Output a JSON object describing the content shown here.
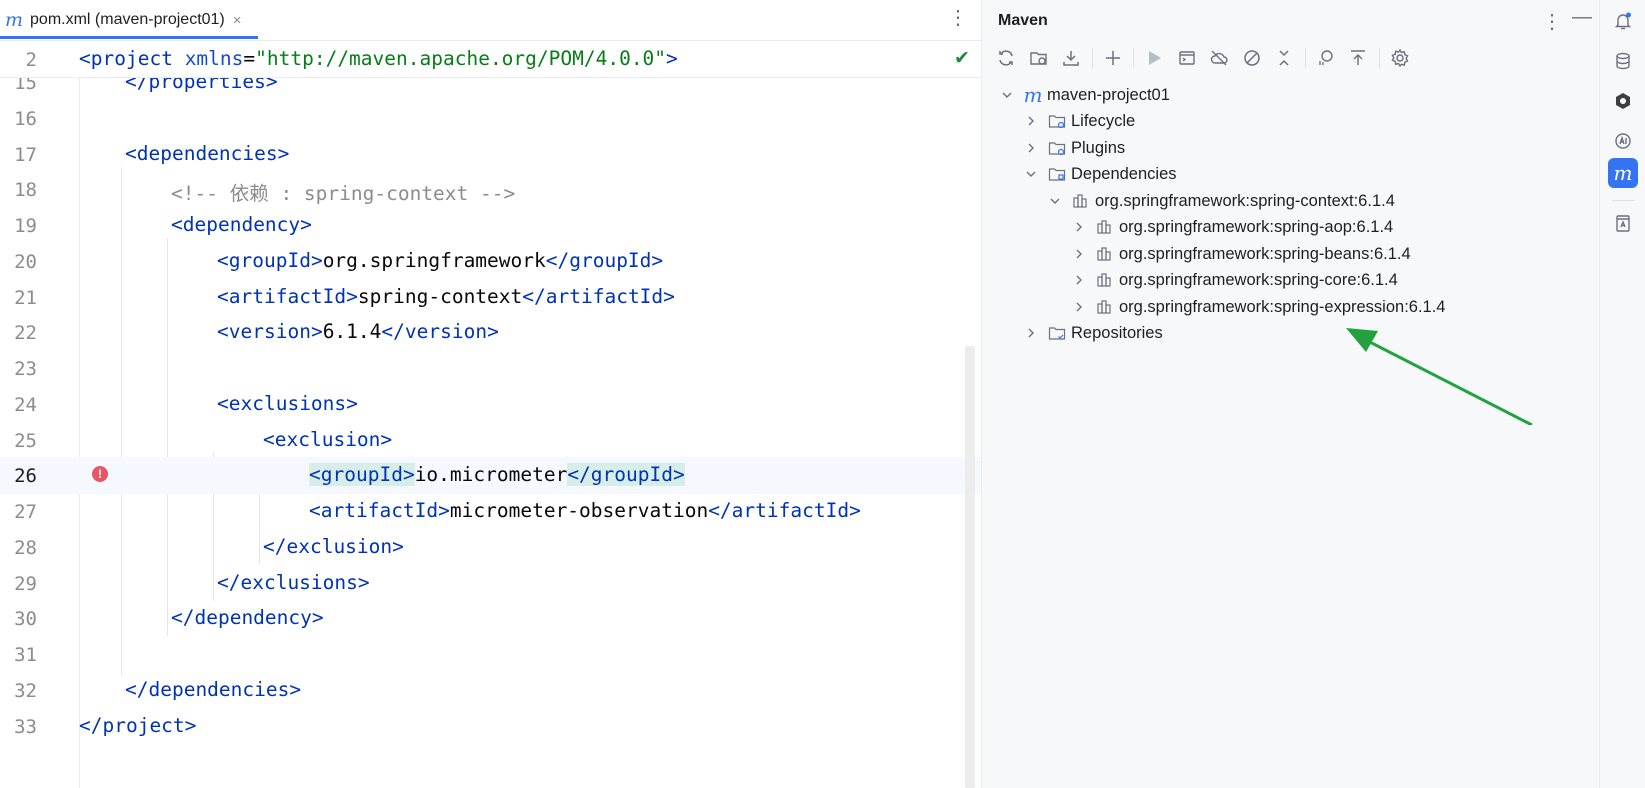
{
  "editor": {
    "tab": {
      "icon": "maven-m-icon",
      "label": "pom.xml (maven-project01)",
      "close": "×"
    },
    "menu": "⋮",
    "sticky_line": {
      "num": "2",
      "open": "<",
      "tag": "project",
      "sp": " ",
      "attr": "xmlns",
      "eq": "=",
      "val": "\"http://maven.apache.org/POM/4.0.0\"",
      "close": ">"
    },
    "lines": [
      {
        "num": "15",
        "a": "</",
        "b": "properties",
        "c": ">"
      },
      {
        "num": "16"
      },
      {
        "num": "17",
        "a": "<",
        "b": "dependencies",
        "c": ">"
      },
      {
        "num": "18",
        "comment": "<!-- 依赖 : spring-context -->"
      },
      {
        "num": "19",
        "a": "<",
        "b": "dependency",
        "c": ">"
      },
      {
        "num": "20",
        "a": "<",
        "b": "groupId",
        "c": ">",
        "text": "org.springframework",
        "d": "</",
        "e": "groupId",
        "f": ">"
      },
      {
        "num": "21",
        "a": "<",
        "b": "artifactId",
        "c": ">",
        "text": "spring-context",
        "d": "</",
        "e": "artifactId",
        "f": ">"
      },
      {
        "num": "22",
        "a": "<",
        "b": "version",
        "c": ">",
        "text": "6.1.4",
        "d": "</",
        "e": "version",
        "f": ">"
      },
      {
        "num": "23"
      },
      {
        "num": "24",
        "a": "<",
        "b": "exclusions",
        "c": ">"
      },
      {
        "num": "25",
        "a": "<",
        "b": "exclusion",
        "c": ">"
      },
      {
        "num": "26",
        "a": "<",
        "b": "groupId",
        "c": ">",
        "text": "io.micrometer",
        "d": "</",
        "e": "groupId",
        "f": ">"
      },
      {
        "num": "27",
        "a": "<",
        "b": "artifactId",
        "c": ">",
        "text": "micrometer-observation",
        "d": "</",
        "e": "artifactId",
        "f": ">"
      },
      {
        "num": "28",
        "a": "</",
        "b": "exclusion",
        "c": ">"
      },
      {
        "num": "29",
        "a": "</",
        "b": "exclusions",
        "c": ">"
      },
      {
        "num": "30",
        "a": "</",
        "b": "dependency",
        "c": ">"
      },
      {
        "num": "31"
      },
      {
        "num": "32",
        "a": "</",
        "b": "dependencies",
        "c": ">"
      },
      {
        "num": "33",
        "a": "</",
        "b": "project",
        "c": ">"
      }
    ],
    "error_mark": "!",
    "inspection_ok": "✔"
  },
  "maven": {
    "title": "Maven",
    "menu": "⋮",
    "minimize": "—",
    "toolbar": [
      "reload-all-icon",
      "reload-projects-icon",
      "download-sources-icon",
      "add-project-icon",
      "run-icon",
      "execute-goal-icon",
      "offline-mode-icon",
      "skip-tests-icon",
      "collapse-icon",
      "dependency-analyzer-icon",
      "show-diagram-icon",
      "settings-icon"
    ],
    "tree": {
      "root": "maven-project01",
      "lifecycle": "Lifecycle",
      "plugins": "Plugins",
      "dependencies": "Dependencies",
      "dep_context": "org.springframework:spring-context:6.1.4",
      "dep_aop": "org.springframework:spring-aop:6.1.4",
      "dep_beans": "org.springframework:spring-beans:6.1.4",
      "dep_core": "org.springframework:spring-core:6.1.4",
      "dep_expression": "org.springframework:spring-expression:6.1.4",
      "repositories": "Repositories"
    },
    "annotation_color": "#23a13f"
  },
  "strip": {
    "items": [
      "notifications-icon",
      "database-icon",
      "plugin-icon",
      "ai-assistant-icon",
      "maven-icon",
      "translate-icon"
    ],
    "active": "maven-icon",
    "accent": "#3574f0"
  }
}
